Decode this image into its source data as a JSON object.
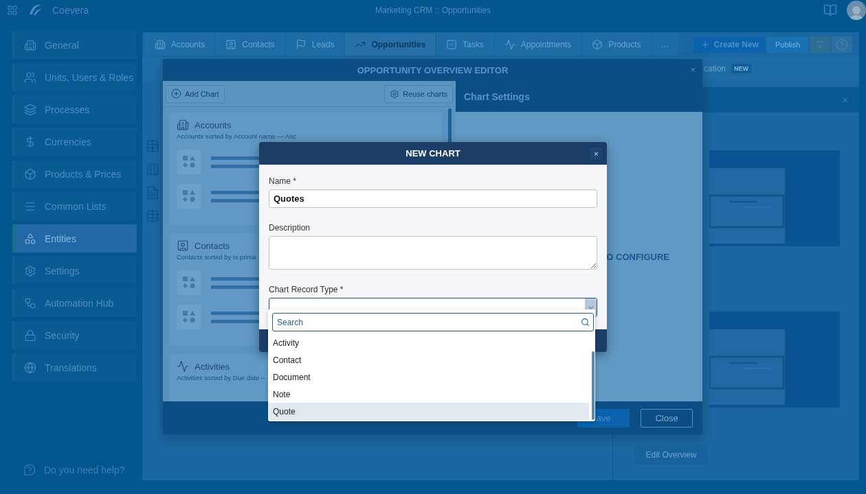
{
  "app": {
    "logo": "Coevera",
    "title": "Marketing CRM :: Opportunities"
  },
  "sidebar": {
    "items": [
      {
        "label": "General",
        "selected": false
      },
      {
        "label": "Units, Users & Roles",
        "selected": false
      },
      {
        "label": "Processes",
        "selected": false
      },
      {
        "label": "Currencies",
        "selected": false
      },
      {
        "label": "Products & Prices",
        "selected": false
      },
      {
        "label": "Common Lists",
        "selected": false
      },
      {
        "label": "Entities",
        "selected": true
      },
      {
        "label": "Settings",
        "selected": false
      },
      {
        "label": "Automation Hub",
        "selected": false
      },
      {
        "label": "Security",
        "selected": false
      },
      {
        "label": "Translations",
        "selected": false
      }
    ],
    "help": "Do you need help?"
  },
  "tabs": [
    {
      "label": "Accounts",
      "selected": false
    },
    {
      "label": "Contacts",
      "selected": false
    },
    {
      "label": "Leads",
      "selected": false
    },
    {
      "label": "Opportunities",
      "selected": true
    },
    {
      "label": "Tasks",
      "selected": false
    },
    {
      "label": "Appointments",
      "selected": false
    },
    {
      "label": "Products",
      "selected": false
    },
    {
      "label": "...",
      "selected": false
    }
  ],
  "toolbar": {
    "create": "Create New",
    "publish": "Publish"
  },
  "subbar": {
    "text": "cation",
    "badge": "NEW"
  },
  "side_panel": {
    "close": "×",
    "button": "Edit Overview"
  },
  "editor": {
    "title": "OPPORTUNITY OVERVIEW EDITOR",
    "close": "×",
    "add_chart": "Add Chart",
    "reuse": "Reuse charts",
    "charts": [
      {
        "title": "Accounts",
        "subtitle": "Accounts sorted by Account name — Asc"
      },
      {
        "title": "Contacts",
        "subtitle": "Contacts sorted by Is prima"
      },
      {
        "title": "Activities",
        "subtitle": "Activities sorted by Due date –"
      }
    ],
    "settings_title": "Chart Settings",
    "settings_hint": "O CONFIGURE",
    "save": "ave",
    "close_button": "Close"
  },
  "new_chart": {
    "title": "NEW CHART",
    "close": "×",
    "name": {
      "label": "Name *",
      "value": "Quotes"
    },
    "description": {
      "label": "Description"
    },
    "record_type": {
      "label": "Chart Record Type *"
    },
    "dropdown": {
      "placeholder": "Search",
      "options": [
        {
          "label": "Activity",
          "selected": false
        },
        {
          "label": "Contact",
          "selected": false
        },
        {
          "label": "Document",
          "selected": false
        },
        {
          "label": "Note",
          "selected": false
        },
        {
          "label": "Quote",
          "selected": true
        }
      ]
    }
  }
}
